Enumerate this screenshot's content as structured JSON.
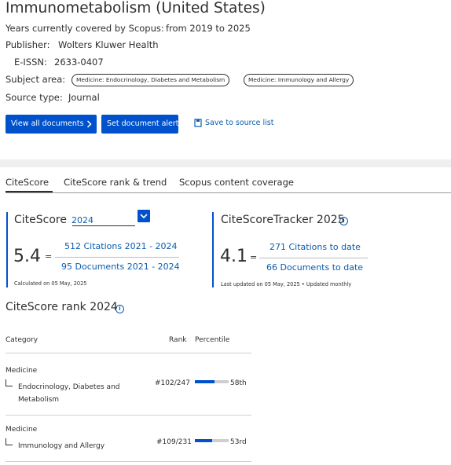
{
  "source": {
    "title": "Immunometabolism (United States)",
    "years_label": "Years currently covered by Scopus:",
    "years_value": "from 2019 to 2025",
    "publisher_label": "Publisher:",
    "publisher_value": "Wolters Kluwer Health",
    "eissn_label": "E-ISSN:",
    "eissn_value": "2633-0407",
    "subject_label": "Subject area:",
    "subjects": [
      "Medicine: Endocrinology, Diabetes and Metabolism",
      "Medicine: Immunology and Allergy"
    ],
    "source_type_label": "Source type:",
    "source_type_value": "Journal"
  },
  "actions": {
    "view_all": "View all documents",
    "set_alert": "Set document alert",
    "save_to_list": "Save to source list"
  },
  "tabs": [
    "CiteScore",
    "CiteScore rank & trend",
    "Scopus content coverage"
  ],
  "active_tab": 0,
  "citescore": {
    "label": "CiteScore",
    "year_selected": "2024",
    "value": "5.4",
    "equals": "=",
    "numerator": "512 Citations 2021 - 2024",
    "denominator": "95 Documents 2021 - 2024",
    "calculated": "Calculated on 05 May, 2025"
  },
  "tracker": {
    "label": "CiteScoreTracker 2025",
    "value": "4.1",
    "equals": "=",
    "numerator": "271 Citations to date",
    "denominator": "66 Documents to date",
    "updated": "Last updated on 05 May, 2025 • Updated monthly"
  },
  "rank": {
    "title": "CiteScore rank 2024",
    "headers": {
      "category": "Category",
      "rank": "Rank",
      "percentile": "Percentile"
    },
    "rows": [
      {
        "parent": "Medicine",
        "sub_line1": "Endocrinology, Diabetes and",
        "sub_line2": "Metabolism",
        "rank": "#102/247",
        "percentile_label": "58th",
        "percentile": 58
      },
      {
        "parent": "Medicine",
        "sub_line1": "Immunology and Allergy",
        "sub_line2": "",
        "rank": "#109/231",
        "percentile_label": "53rd",
        "percentile": 53
      }
    ]
  },
  "colors": {
    "accent": "#0052cc",
    "link": "#0b5cad",
    "text": "#2e2e2e"
  },
  "icons": {
    "save": "bookmark-icon",
    "info": "info-icon",
    "dropdown": "chevron-down-icon",
    "view_all_chevron": "chevron-right-icon"
  }
}
